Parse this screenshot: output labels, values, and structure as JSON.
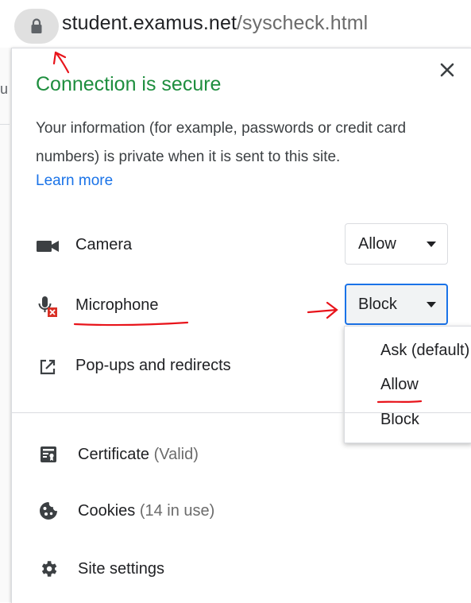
{
  "address_bar": {
    "host": "student.examus.net",
    "path": "/syscheck.html",
    "lock_icon": "lock-icon"
  },
  "background_page": {
    "partial_text": "u"
  },
  "site_info_popup": {
    "title": "Connection is secure",
    "description": "Your information (for example, passwords or credit card numbers) is private when it is sent to this site.",
    "learn_more": "Learn more",
    "close_icon": "close-icon",
    "permissions": [
      {
        "icon": "camera-icon",
        "label": "Camera",
        "value": "Allow"
      },
      {
        "icon": "microphone-blocked-icon",
        "label": "Microphone",
        "value": "Block"
      },
      {
        "icon": "external-link-icon",
        "label": "Pop-ups and redirects"
      }
    ],
    "dropdown_options": [
      "Ask (default)",
      "Allow",
      "Block"
    ],
    "bottom_items": [
      {
        "icon": "certificate-icon",
        "label": "Certificate",
        "sub": "(Valid)"
      },
      {
        "icon": "cookie-icon",
        "label": "Cookies",
        "sub": "(14 in use)"
      },
      {
        "icon": "gear-icon",
        "label": "Site settings"
      }
    ]
  },
  "colors": {
    "secure_green": "#1e8e3e",
    "link_blue": "#1a73e8",
    "annotation_red": "#e8141b",
    "blocked_red": "#d93025"
  }
}
